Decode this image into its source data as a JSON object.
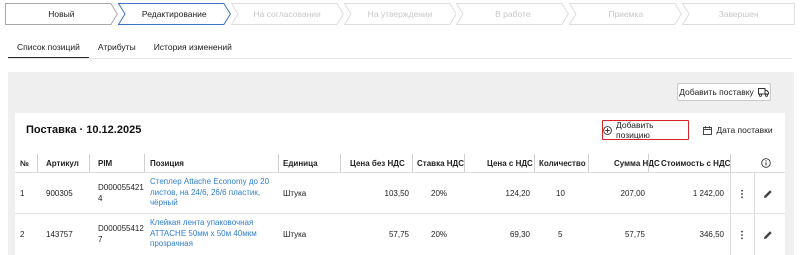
{
  "stages": [
    {
      "label": "Новый",
      "state": "done"
    },
    {
      "label": "Редактирование",
      "state": "active"
    },
    {
      "label": "На согласовании",
      "state": "pending"
    },
    {
      "label": "На утверждении",
      "state": "pending"
    },
    {
      "label": "В работе",
      "state": "pending"
    },
    {
      "label": "Приемка",
      "state": "pending"
    },
    {
      "label": "Завершен",
      "state": "pending"
    }
  ],
  "tabs": [
    {
      "label": "Список позиций",
      "active": true
    },
    {
      "label": "Атрибуты",
      "active": false
    },
    {
      "label": "История изменений",
      "active": false
    }
  ],
  "toolbar": {
    "add_delivery_label": "Добавить поставку"
  },
  "delivery": {
    "title": "Поставка · 10.12.2025",
    "add_position_label": "Добавить позицию",
    "delivery_date_label": "Дата поставки"
  },
  "table": {
    "headers": [
      "№",
      "Артикул",
      "PIM",
      "Позиция",
      "Единица",
      "Цена без НДС",
      "Ставка НДС",
      "Цена с НДС",
      "Количество",
      "Сумма НДС",
      "Стоимость с НДС"
    ],
    "rows": [
      {
        "num": "1",
        "article": "900305",
        "pim": [
          "D000055421",
          "4"
        ],
        "position": [
          "Степлер Attache Economy до 20",
          "листов, на 24/6, 26/6 пластик,",
          "чёрный"
        ],
        "unit": "Штука",
        "price_no_vat": "103,50",
        "vat_rate": "20%",
        "price_vat": "124,20",
        "qty": "10",
        "vat_sum": "207,00",
        "total": "1 242,00"
      },
      {
        "num": "2",
        "article": "143757",
        "pim": [
          "D000055412",
          "7"
        ],
        "position": [
          "Клейкая лента упаковочная",
          "ATTACHE 50мм х 50м 40мкм",
          "прозрачная"
        ],
        "unit": "Штука",
        "price_no_vat": "57,75",
        "vat_rate": "20%",
        "price_vat": "69,30",
        "qty": "5",
        "vat_sum": "57,75",
        "total": "346,50"
      }
    ]
  },
  "colors": {
    "accent_border": "#d9232b",
    "link": "#2f7fd0",
    "panel": "#efefef"
  }
}
